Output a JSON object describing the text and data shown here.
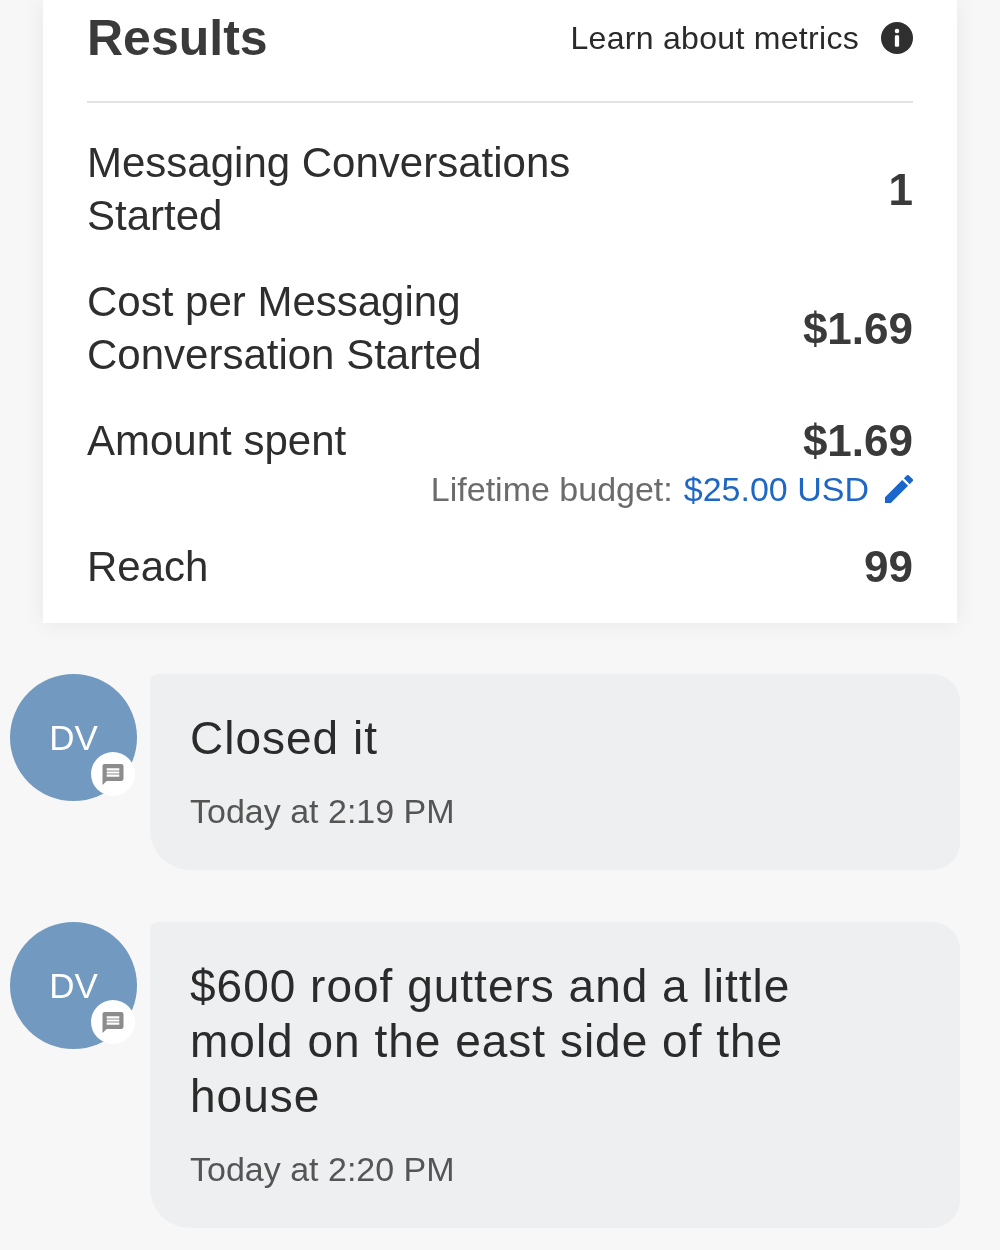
{
  "results": {
    "title": "Results",
    "learn_link": "Learn about metrics"
  },
  "metrics": [
    {
      "label": "Messaging Conversations Started",
      "value": "1"
    },
    {
      "label": "Cost per Messaging Conversation Started",
      "value": "$1.69"
    },
    {
      "label": "Amount spent",
      "value": "$1.69",
      "budget": {
        "label": "Lifetime budget:",
        "amount": "$25.00 USD"
      }
    },
    {
      "label": "Reach",
      "value": "99"
    }
  ],
  "messages": [
    {
      "initials": "DV",
      "text": "Closed it",
      "time": "Today at 2:19 PM"
    },
    {
      "initials": "DV",
      "text": "$600 roof gutters and a little mold on the east side of the house",
      "time": "Today at 2:20 PM"
    }
  ]
}
